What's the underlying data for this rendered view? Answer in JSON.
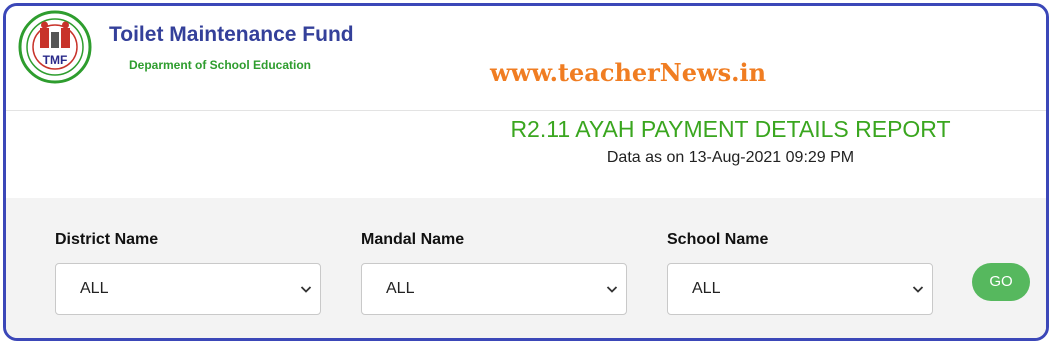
{
  "header": {
    "title": "Toilet Maintenance Fund",
    "subtitle": "Deparment of School Education",
    "logo_text": "TMF",
    "watermark": "www.teacherNews.in"
  },
  "report": {
    "title": "R2.11 AYAH PAYMENT DETAILS REPORT",
    "data_as_on": "Data as on 13-Aug-2021 09:29 PM"
  },
  "filters": [
    {
      "label": "District Name",
      "value": "ALL",
      "icon": "chevron-down-icon"
    },
    {
      "label": "Mandal Name",
      "value": "ALL",
      "icon": "chevron-down-icon"
    },
    {
      "label": "School Name",
      "value": "ALL",
      "icon": "chevron-down-icon"
    }
  ],
  "go_button": {
    "label": "GO"
  },
  "colors": {
    "frame_border": "#3b47b8",
    "title_blue": "#34409a",
    "subtitle_green": "#2e9d2e",
    "report_green": "#3aa61f",
    "watermark_orange": "#f07d22",
    "go_green": "#56b85e",
    "logo_red": "#c8342b"
  }
}
